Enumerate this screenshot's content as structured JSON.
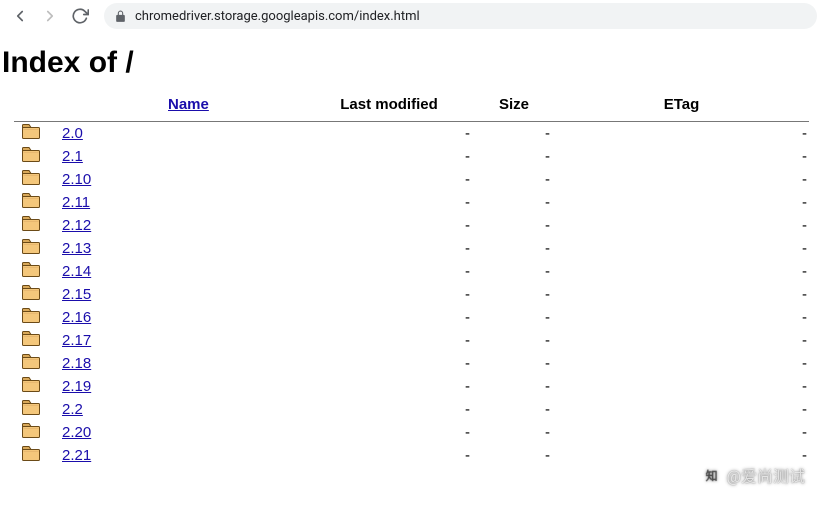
{
  "browser": {
    "url": "chromedriver.storage.googleapis.com/index.html"
  },
  "page": {
    "title": "Index of /",
    "columns": {
      "name": "Name",
      "last_modified": "Last modified",
      "size": "Size",
      "etag": "ETag"
    },
    "entries": [
      {
        "name": "2.0",
        "last_modified": "-",
        "size": "-",
        "etag": "-"
      },
      {
        "name": "2.1",
        "last_modified": "-",
        "size": "-",
        "etag": "-"
      },
      {
        "name": "2.10",
        "last_modified": "-",
        "size": "-",
        "etag": "-"
      },
      {
        "name": "2.11",
        "last_modified": "-",
        "size": "-",
        "etag": "-"
      },
      {
        "name": "2.12",
        "last_modified": "-",
        "size": "-",
        "etag": "-"
      },
      {
        "name": "2.13",
        "last_modified": "-",
        "size": "-",
        "etag": "-"
      },
      {
        "name": "2.14",
        "last_modified": "-",
        "size": "-",
        "etag": "-"
      },
      {
        "name": "2.15",
        "last_modified": "-",
        "size": "-",
        "etag": "-"
      },
      {
        "name": "2.16",
        "last_modified": "-",
        "size": "-",
        "etag": "-"
      },
      {
        "name": "2.17",
        "last_modified": "-",
        "size": "-",
        "etag": "-"
      },
      {
        "name": "2.18",
        "last_modified": "-",
        "size": "-",
        "etag": "-"
      },
      {
        "name": "2.19",
        "last_modified": "-",
        "size": "-",
        "etag": "-"
      },
      {
        "name": "2.2",
        "last_modified": "-",
        "size": "-",
        "etag": "-"
      },
      {
        "name": "2.20",
        "last_modified": "-",
        "size": "-",
        "etag": "-"
      },
      {
        "name": "2.21",
        "last_modified": "-",
        "size": "-",
        "etag": "-"
      }
    ]
  },
  "watermark": {
    "logo_text": "知",
    "text": "@爱尚测试"
  }
}
